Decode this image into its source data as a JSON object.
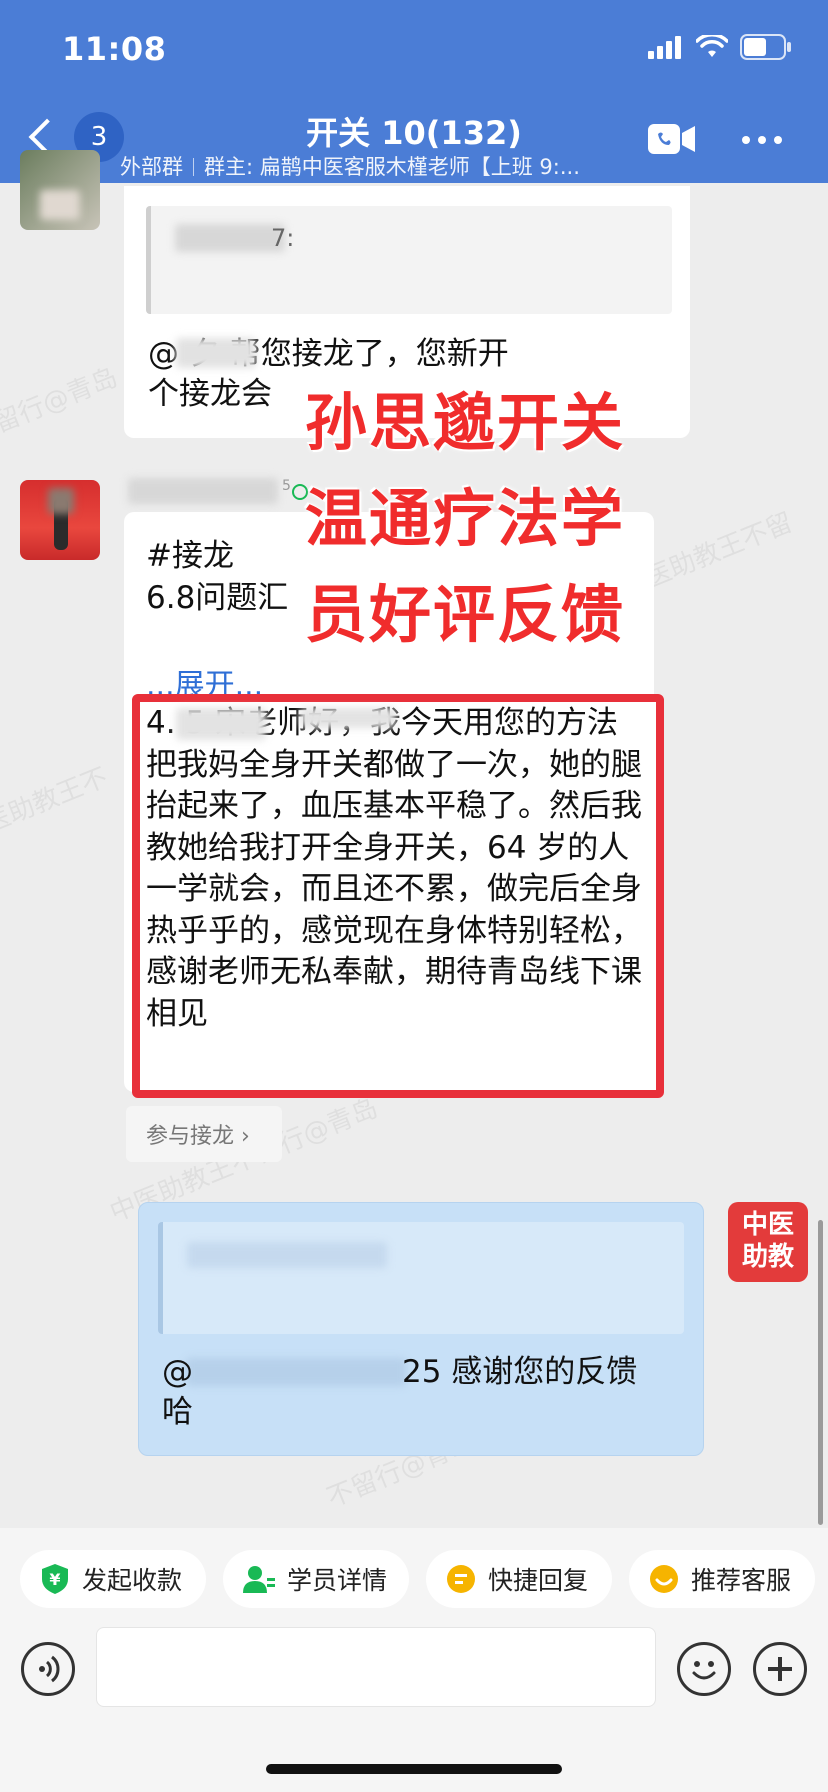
{
  "status_bar": {
    "time": "11:08"
  },
  "header": {
    "unread_count": "3",
    "title": "开关 10(132)",
    "group_type": "外部群",
    "group_owner": "群主: 扁鹊中医客服木槿老师【上班 9:..."
  },
  "messages": {
    "first": {
      "quote_fragment": "7:",
      "text": "@  夕 帮您接龙了，您新开\n个接龙会"
    },
    "second": {
      "name_suffix": "5",
      "lines": [
        "#接龙",
        "6.8问题汇"
      ],
      "expand_label": "...展开...",
      "highlight_text": "4.                 5   宋老师好，我今天用您的方法把我妈全身开关都做了一次，她的腿抬起来了，血压基本平稳了。然后我教她给我打开全身开关，64 岁的人一学就会，而且还不累，做完后全身热乎乎的，感觉现在身体特别轻松，感谢老师无私奉献，期待青岛线下课相见",
      "join_label": "参与接龙 ›"
    },
    "reply": {
      "text_suffix": "25 感谢您的反馈\n哈",
      "prefix": "@",
      "avatar_label_line1": "中医",
      "avatar_label_line2": "助教"
    }
  },
  "overlay": {
    "line1": "孙思邈开关",
    "line2": "温通疗法学",
    "line3": "员好评反馈"
  },
  "quick_actions": [
    {
      "label": "发起收款",
      "icon": "payment-icon",
      "color": "#19b955"
    },
    {
      "label": "学员详情",
      "icon": "student-icon",
      "color": "#19b955"
    },
    {
      "label": "快捷回复",
      "icon": "quick-reply-icon",
      "color": "#f6b400"
    },
    {
      "label": "推荐客服",
      "icon": "recommend-icon",
      "color": "#f6b400"
    }
  ],
  "colors": {
    "header_bg": "#4b7dd6",
    "highlight_border": "#e8303a",
    "overlay_text": "#f02c2c",
    "link": "#2f6fd6",
    "sent_bubble": "#c7e0f7"
  }
}
